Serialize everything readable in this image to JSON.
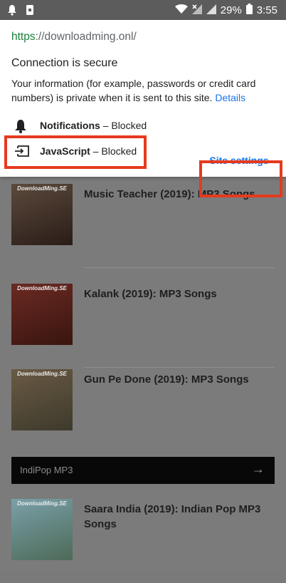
{
  "status_bar": {
    "battery": "29%",
    "time": "3:55"
  },
  "site_info": {
    "url_scheme": "https",
    "url_rest": "://downloadming.onl/",
    "connection_title": "Connection is secure",
    "connection_description": "Your information (for example, passwords or credit card numbers) is private when it is sent to this site.",
    "details_link": "Details",
    "permissions": [
      {
        "name": "Notifications",
        "state": "Blocked",
        "icon": "bell-icon"
      },
      {
        "name": "JavaScript",
        "state": "Blocked",
        "icon": "javascript-icon"
      }
    ],
    "site_settings_label": "Site settings"
  },
  "page": {
    "brand_label": "DownloadMing.SE",
    "posts": [
      {
        "title": "Music Teacher (2019): MP3 Songs"
      },
      {
        "title": "Kalank (2019): MP3 Songs"
      },
      {
        "title": "Gun Pe Done (2019): MP3 Songs"
      },
      {
        "title": "Saara India (2019): Indian Pop MP3 Songs"
      }
    ],
    "section_label": "IndiPop MP3",
    "section_arrow": "→"
  },
  "colors": {
    "accent": "#1a73e8",
    "highlight": "#e53a1f",
    "secure_green": "#188038"
  }
}
